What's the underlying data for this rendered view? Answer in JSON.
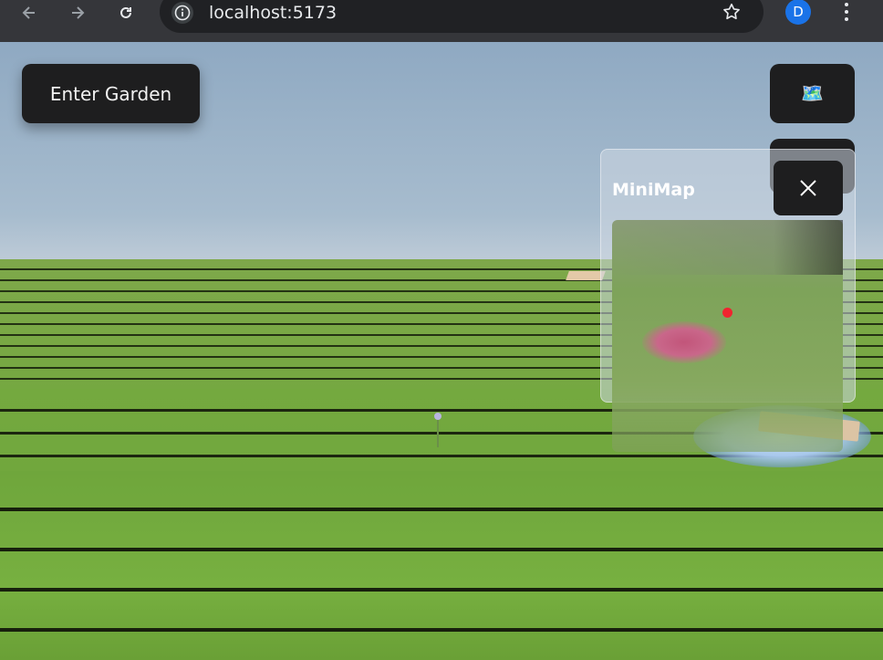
{
  "browser": {
    "url": "localhost:5173",
    "profile_initial": "D",
    "icons": {
      "back": "arrow-left-icon",
      "forward": "arrow-right-icon",
      "reload": "reload-icon",
      "site_info": "info-icon",
      "bookmark": "star-icon",
      "menu": "kebab-menu-icon"
    },
    "colors": {
      "chrome": "#35363a",
      "omnibox": "#202124",
      "profile": "#1a73e8"
    }
  },
  "scene": {
    "enter_button_label": "Enter Garden",
    "map_button_icon": "🗺️",
    "colors": {
      "button_bg": "#1e1e1f",
      "grass": "#73a83f",
      "sky": "#a7bcce"
    }
  },
  "minimap": {
    "title": "MiniMap",
    "close_icon": "close-icon",
    "player_marker_color": "#f0242f"
  }
}
